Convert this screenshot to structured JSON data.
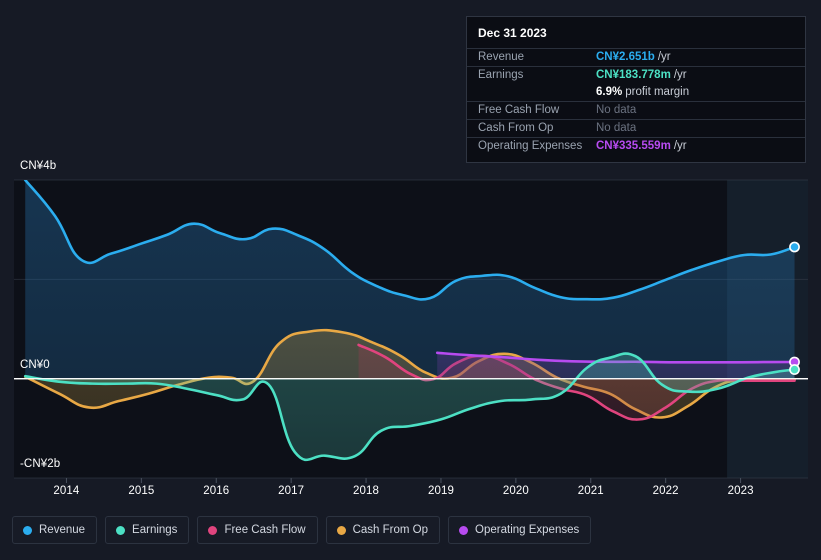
{
  "tooltip": {
    "date": "Dec 31 2023",
    "rows": [
      {
        "key": "Revenue",
        "value": "CN¥2.651b",
        "unit": "/yr",
        "color": "#2badef",
        "nodata": false
      },
      {
        "key": "Earnings",
        "value": "CN¥183.778m",
        "unit": "/yr",
        "color": "#4ce0c4",
        "nodata": false
      },
      {
        "key": "",
        "value": "6.9%",
        "unit": "profit margin",
        "color": "#ffffff",
        "nodata": false
      },
      {
        "key": "Free Cash Flow",
        "value": "No data",
        "unit": "",
        "color": "#6b7280",
        "nodata": true
      },
      {
        "key": "Cash From Op",
        "value": "No data",
        "unit": "",
        "color": "#6b7280",
        "nodata": true
      },
      {
        "key": "Operating Expenses",
        "value": "CN¥335.559m",
        "unit": "/yr",
        "color": "#b74bf0",
        "nodata": false
      }
    ]
  },
  "legend": {
    "items": [
      {
        "label": "Revenue",
        "color": "#2badef"
      },
      {
        "label": "Earnings",
        "color": "#4ce0c4"
      },
      {
        "label": "Free Cash Flow",
        "color": "#e0447e"
      },
      {
        "label": "Cash From Op",
        "color": "#e8a845"
      },
      {
        "label": "Operating Expenses",
        "color": "#b74bf0"
      }
    ]
  },
  "chart_data": {
    "type": "area",
    "title": "",
    "xlabel": "",
    "ylabel": "",
    "grid": true,
    "legend_position": "bottom",
    "ylim": [
      -2,
      4
    ],
    "yticks": [
      4,
      2,
      0,
      -2
    ],
    "ytick_labels": [
      "CN¥4b",
      "",
      "CN¥0",
      "-CN¥2b"
    ],
    "y_axis_units": "CN¥ billions",
    "xlim": [
      2013.3,
      2023.9
    ],
    "xticks": [
      2014,
      2015,
      2016,
      2017,
      2018,
      2019,
      2020,
      2021,
      2022,
      2023
    ],
    "xtick_labels": [
      "2014",
      "2015",
      "2016",
      "2017",
      "2018",
      "2019",
      "2020",
      "2021",
      "2022",
      "2023"
    ],
    "forecast_band_start": 2022.82,
    "series": [
      {
        "name": "Revenue",
        "color": "#2badef",
        "fill": "rgba(35,105,160,0.42)",
        "x": [
          2013.45,
          2013.85,
          2014.2,
          2014.6,
          2015.0,
          2015.35,
          2015.7,
          2016.05,
          2016.4,
          2016.75,
          2017.1,
          2017.45,
          2017.8,
          2018.15,
          2018.5,
          2018.85,
          2019.2,
          2019.55,
          2019.9,
          2020.25,
          2020.6,
          2020.95,
          2021.3,
          2021.65,
          2022.0,
          2022.35,
          2022.7,
          2023.05,
          2023.4,
          2023.72
        ],
        "y": [
          4.0,
          3.27,
          2.39,
          2.52,
          2.72,
          2.9,
          3.12,
          2.93,
          2.81,
          3.02,
          2.88,
          2.6,
          2.15,
          1.86,
          1.68,
          1.62,
          1.97,
          2.07,
          2.06,
          1.83,
          1.64,
          1.6,
          1.63,
          1.79,
          1.99,
          2.19,
          2.36,
          2.49,
          2.5,
          2.651
        ]
      },
      {
        "name": "Earnings",
        "color": "#4ce0c4",
        "fill": "rgba(78,200,180,0.30)",
        "x": [
          2013.45,
          2013.9,
          2014.35,
          2014.8,
          2015.2,
          2015.6,
          2016.0,
          2016.35,
          2016.7,
          2017.05,
          2017.45,
          2017.85,
          2018.2,
          2018.6,
          2019.0,
          2019.4,
          2019.8,
          2020.2,
          2020.6,
          2020.95,
          2021.25,
          2021.6,
          2021.95,
          2022.3,
          2022.7,
          2023.1,
          2023.45,
          2023.72
        ],
        "y": [
          0.05,
          -0.06,
          -0.1,
          -0.1,
          -0.1,
          -0.2,
          -0.33,
          -0.42,
          -0.12,
          -1.48,
          -1.55,
          -1.56,
          -1.05,
          -0.95,
          -0.82,
          -0.6,
          -0.45,
          -0.42,
          -0.3,
          0.22,
          0.42,
          0.45,
          -0.12,
          -0.26,
          -0.2,
          0.02,
          0.13,
          0.184
        ]
      },
      {
        "name": "Cash From Op",
        "color": "#e8a845",
        "fill": "rgba(160,130,60,0.40)",
        "x": [
          2013.45,
          2013.9,
          2014.3,
          2014.7,
          2015.1,
          2015.5,
          2015.9,
          2016.2,
          2016.5,
          2016.85,
          2017.25,
          2017.7,
          2018.1,
          2018.45,
          2018.8,
          2019.15,
          2019.5,
          2019.85,
          2020.2,
          2020.55,
          2020.9,
          2021.25,
          2021.6,
          2021.95,
          2022.3,
          2022.65,
          2023.0,
          2023.4,
          2023.72
        ],
        "y": [
          0.04,
          -0.3,
          -0.58,
          -0.45,
          -0.3,
          -0.12,
          0.02,
          0.02,
          -0.05,
          0.72,
          0.95,
          0.93,
          0.72,
          0.47,
          0.12,
          0.02,
          0.35,
          0.5,
          0.33,
          0.02,
          -0.16,
          -0.3,
          -0.62,
          -0.78,
          -0.55,
          -0.18,
          -0.02,
          -0.02,
          -0.02
        ]
      },
      {
        "name": "Free Cash Flow",
        "color": "#e0447e",
        "fill": "rgba(150,60,80,0.34)",
        "x": [
          2017.9,
          2018.25,
          2018.6,
          2018.9,
          2019.2,
          2019.55,
          2019.9,
          2020.25,
          2020.6,
          2020.95,
          2021.3,
          2021.65,
          2022.0,
          2022.35,
          2022.7,
          2023.05,
          2023.4,
          2023.72
        ],
        "y": [
          0.68,
          0.44,
          0.09,
          -0.01,
          0.31,
          0.46,
          0.3,
          -0.01,
          -0.2,
          -0.34,
          -0.66,
          -0.82,
          -0.58,
          -0.2,
          -0.04,
          -0.04,
          -0.04,
          -0.04
        ]
      },
      {
        "name": "Operating Expenses",
        "color": "#b74bf0",
        "fill": "rgba(110,60,160,0.34)",
        "x": [
          2018.95,
          2019.4,
          2019.85,
          2020.3,
          2020.75,
          2021.2,
          2021.65,
          2022.1,
          2022.55,
          2023.0,
          2023.4,
          2023.72
        ],
        "y": [
          0.52,
          0.47,
          0.43,
          0.38,
          0.35,
          0.34,
          0.34,
          0.33,
          0.33,
          0.33,
          0.335,
          0.3356
        ]
      }
    ],
    "endpoints": [
      {
        "name": "Revenue",
        "x": 2023.72,
        "y": 2.651,
        "color": "#2badef"
      },
      {
        "name": "Operating Expenses",
        "x": 2023.72,
        "y": 0.3356,
        "color": "#b74bf0"
      },
      {
        "name": "Earnings",
        "x": 2023.72,
        "y": 0.184,
        "color": "#4ce0c4"
      }
    ]
  }
}
